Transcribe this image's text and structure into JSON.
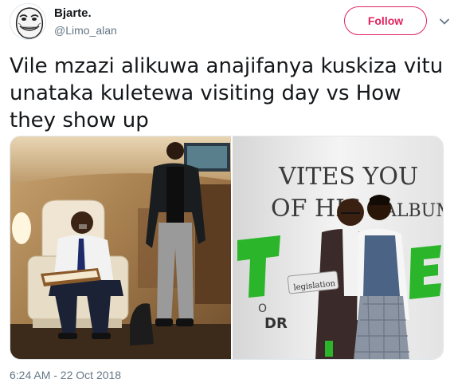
{
  "author": {
    "name": "Bjarte.",
    "handle": "@Limo_alan",
    "avatar_icon": "trollface-avatar"
  },
  "actions": {
    "follow_label": "Follow",
    "menu_icon": "chevron-down-icon"
  },
  "tweet": {
    "text": "Vile mzazi alikuwa anajifanya kuskiza vitu unataka kuletewa visiting day vs How they show up",
    "timestamp": "6:24 AM - 22 Oct 2018"
  },
  "media": {
    "poster_text_top": "VITES YOU",
    "poster_text_mid": "OF HIS",
    "poster_text_album": "ALBUM",
    "book_label": "legislation",
    "poster_text_dr": "DR",
    "poster_text_o": "O"
  },
  "colors": {
    "accent": "#e0245e",
    "text": "#14171a",
    "muted": "#657786"
  }
}
